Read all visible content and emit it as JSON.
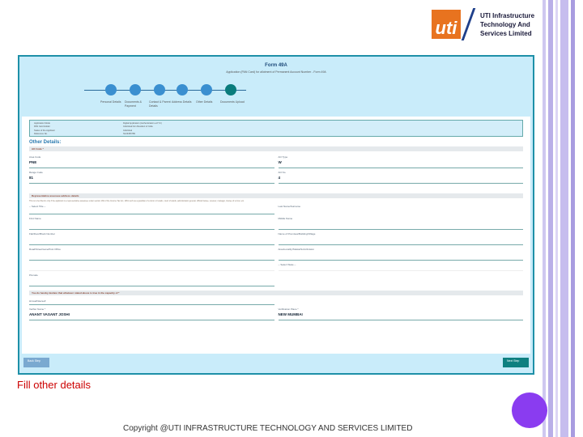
{
  "logo": {
    "mark": "uti",
    "text": [
      "UTI Infrastructure",
      "Technology And",
      "Services Limited"
    ]
  },
  "form": {
    "title": "Form 49A",
    "subtitle": "Application (PAN Card) for allotment of Permanent Account Number - Form 49A",
    "steps": [
      "Personal Details",
      "Documents & Payment",
      "Contact & Parent Details",
      "Address Details",
      "Other Details",
      "Documents Upload"
    ],
    "info": [
      [
        "Application Mode",
        "Digital Application (Authentication e-KYC)"
      ],
      [
        "PAN Card Holder",
        "Individual Non Resident of India"
      ],
      [
        "Status of the Applicant",
        "Individual"
      ],
      [
        "Reference No.",
        "N123456789"
      ]
    ],
    "section_title": "Other Details:",
    "ao_label": "AO Code *",
    "ao": [
      {
        "label": "Area Code",
        "value": "PNE"
      },
      {
        "label": "AO Type",
        "value": "W"
      },
      {
        "label": "Range Code",
        "value": "81"
      },
      {
        "label": "AO No",
        "value": "4"
      }
    ],
    "rep_label": "Representative assessee address details",
    "rep_note": "This is to be filled in only if the applicant is a representative assessee under section 160 of the Income Tax Act, 1961 such as a guardian of a minor or lunatic, court of wards, administrator general, official trustee, receiver, manager, trustee of a trust, etc.",
    "rep_fields": [
      "-- Select Title --",
      "Last Name/Surname",
      "First Name",
      "Middle Name",
      "Flat/Door/Block Number",
      "Name of Premises/Building/Village",
      "Road/Street/Lane/Post Office",
      "Area/Locality/Taluka/Sub-Division",
      "",
      "-- Select State --",
      "Pincode"
    ],
    "declare_label": "You do hereby declare that whatever stated above is true in the capacity of *",
    "capacity": "Himself/Herself",
    "verifier": {
      "label": "Verifier Name *",
      "value": "ANANT VASANT JOSHI"
    },
    "place": {
      "label": "Verification Place *",
      "value": "NEW MUMBAI"
    },
    "back": "Back Step",
    "next": "Next Step"
  },
  "caption": "Fill other details",
  "copyright": "Copyright @UTI INFRASTRUCTURE TECHNOLOGY AND SERVICES LIMITED"
}
